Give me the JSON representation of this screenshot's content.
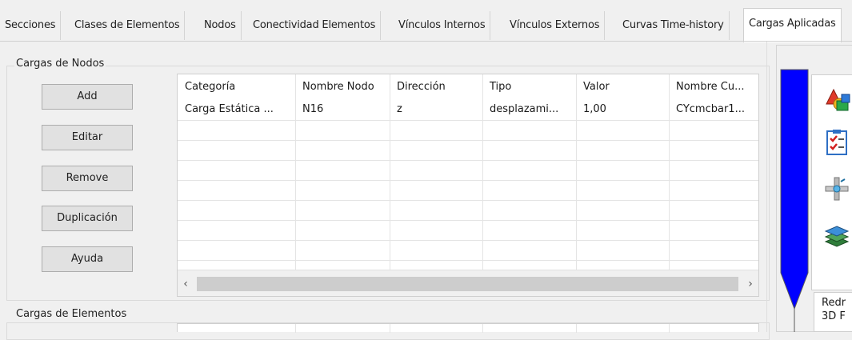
{
  "tabs": [
    {
      "label": "Secciones"
    },
    {
      "label": "Clases de Elementos"
    },
    {
      "label": "Nodos"
    },
    {
      "label": "Conectividad Elementos"
    },
    {
      "label": "Vínculos Internos"
    },
    {
      "label": "Vínculos Externos"
    },
    {
      "label": "Curvas Time-history"
    },
    {
      "label": "Cargas Aplicadas",
      "active": true
    }
  ],
  "node_loads": {
    "title": "Cargas de Nodos",
    "buttons": {
      "add": "Add",
      "edit": "Editar",
      "remove": "Remove",
      "duplicate": "Duplicación",
      "help": "Ayuda"
    },
    "columns": [
      "Categoría",
      "Nombre Nodo",
      "Dirección",
      "Tipo",
      "Valor",
      "Nombre Cu..."
    ],
    "rows": [
      [
        "Carga Estática ...",
        "N16",
        "z",
        "desplazami...",
        "1,00",
        "CYcmcbar1..."
      ]
    ],
    "scroll_left": "‹",
    "scroll_right": "›"
  },
  "element_loads": {
    "title": "Cargas de Elementos"
  },
  "side_panel": {
    "bar_color": "#0000ff",
    "icons": [
      "shapes-icon",
      "checklist-icon",
      "node-connect-icon",
      "layers-icon"
    ],
    "redraw_label": "Redr",
    "redraw_sublabel": "3D F"
  }
}
